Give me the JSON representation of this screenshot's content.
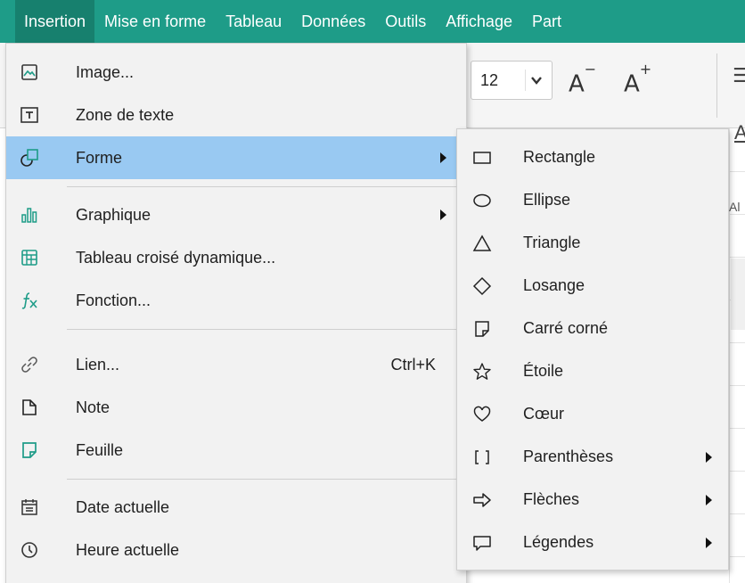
{
  "menubar": {
    "items": [
      {
        "label": "Insertion"
      },
      {
        "label": "Mise en forme"
      },
      {
        "label": "Tableau"
      },
      {
        "label": "Données"
      },
      {
        "label": "Outils"
      },
      {
        "label": "Affichage"
      },
      {
        "label": "Part"
      }
    ],
    "active_color": "#17806e",
    "bar_color": "#1e9c88"
  },
  "ribbon": {
    "font_size_value": "12",
    "decrease_font_label": "A",
    "increase_font_label": "A",
    "decrease_sign": "−",
    "increase_sign": "+",
    "fragment_1": "☰",
    "fragment_2": "A",
    "column_header_fragment": "Al"
  },
  "insert_menu": {
    "items": [
      {
        "label": "Image...",
        "icon": "image-icon"
      },
      {
        "label": "Zone de texte",
        "icon": "text-box-icon"
      },
      {
        "label": "Forme",
        "icon": "shape-icon",
        "highlighted": true,
        "has_submenu": true
      },
      {
        "label": "Graphique",
        "icon": "chart-icon",
        "has_submenu": true
      },
      {
        "label": "Tableau croisé dynamique...",
        "icon": "pivot-table-icon"
      },
      {
        "label": "Fonction...",
        "icon": "function-icon"
      },
      {
        "label": "Lien...",
        "icon": "link-icon",
        "shortcut": "Ctrl+K"
      },
      {
        "label": "Note",
        "icon": "note-icon"
      },
      {
        "label": "Feuille",
        "icon": "sheet-icon"
      },
      {
        "label": "Date actuelle",
        "icon": "calendar-icon"
      },
      {
        "label": "Heure actuelle",
        "icon": "clock-icon"
      }
    ],
    "highlight_color": "#99c9f2"
  },
  "shape_submenu": {
    "items": [
      {
        "label": "Rectangle",
        "icon": "rectangle-icon"
      },
      {
        "label": "Ellipse",
        "icon": "ellipse-icon"
      },
      {
        "label": "Triangle",
        "icon": "triangle-icon"
      },
      {
        "label": "Losange",
        "icon": "diamond-icon"
      },
      {
        "label": "Carré corné",
        "icon": "folded-square-icon"
      },
      {
        "label": "Étoile",
        "icon": "star-icon"
      },
      {
        "label": "Cœur",
        "icon": "heart-icon"
      },
      {
        "label": "Parenthèses",
        "icon": "brackets-icon",
        "has_submenu": true
      },
      {
        "label": "Flèches",
        "icon": "arrow-icon",
        "has_submenu": true
      },
      {
        "label": "Légendes",
        "icon": "callout-icon",
        "has_submenu": true
      }
    ]
  }
}
